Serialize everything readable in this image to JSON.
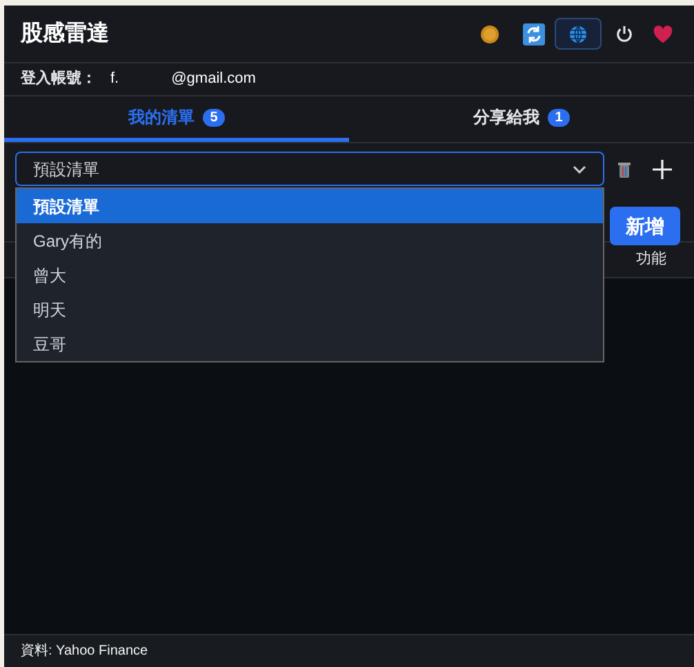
{
  "header": {
    "title": "股感雷達"
  },
  "account": {
    "label": "登入帳號：",
    "user_start": "f.",
    "user_end": "@gmail.com"
  },
  "tabs": [
    {
      "label": "我的清單",
      "count": "5",
      "selected": true
    },
    {
      "label": "分享給我",
      "count": "1",
      "selected": false
    }
  ],
  "list_select": {
    "value": "預設清單",
    "open": true,
    "options": [
      {
        "label": "預設清單",
        "selected": true
      },
      {
        "label": "Gary有的",
        "selected": false
      },
      {
        "label": "曾大",
        "selected": false
      },
      {
        "label": "明天",
        "selected": false
      },
      {
        "label": "豆哥",
        "selected": false
      }
    ]
  },
  "add_button": "新增",
  "table": {
    "columns": [
      "功能"
    ]
  },
  "footer": "資料: Yahoo Finance"
}
